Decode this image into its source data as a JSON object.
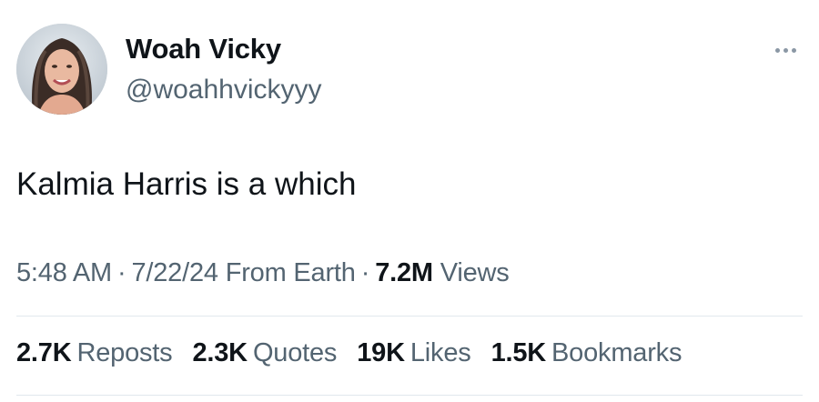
{
  "author": {
    "display_name": "Woah Vicky",
    "handle": "@woahhvickyyy",
    "avatar_icon": "profile-photo"
  },
  "menu": {
    "icon": "more-horizontal-icon"
  },
  "tweet": {
    "text": "Kalmia Harris is a which"
  },
  "meta": {
    "time": "5:48 AM",
    "separator1": "·",
    "date": "7/22/24",
    "source": "From Earth",
    "separator2": "·",
    "views_count": "7.2M",
    "views_label": "Views"
  },
  "stats": [
    {
      "count": "2.7K",
      "label": "Reposts"
    },
    {
      "count": "2.3K",
      "label": "Quotes"
    },
    {
      "count": "19K",
      "label": "Likes"
    },
    {
      "count": "1.5K",
      "label": "Bookmarks"
    }
  ],
  "colors": {
    "primary_text": "#0f1419",
    "secondary_text": "#536471",
    "divider": "#e1e8ed",
    "background": "#ffffff"
  }
}
